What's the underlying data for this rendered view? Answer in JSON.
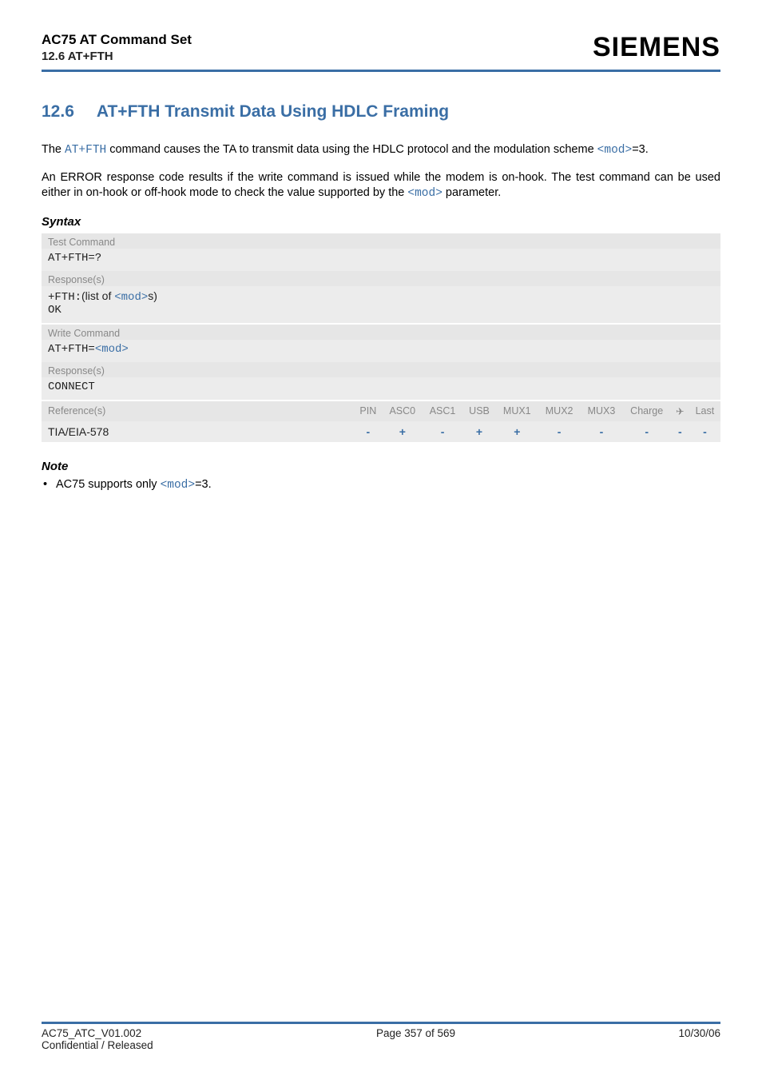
{
  "header": {
    "doc_title": "AC75 AT Command Set",
    "doc_section": "12.6 AT+FTH",
    "brand": "SIEMENS"
  },
  "section": {
    "number": "12.6",
    "title": "AT+FTH   Transmit Data Using HDLC Framing"
  },
  "para1_pre": "The ",
  "para1_link1": "AT+FTH",
  "para1_mid1": " command causes the TA to transmit data using the HDLC protocol and the modulation scheme ",
  "para1_link2": "<mod>",
  "para1_post": "=3.",
  "para2_pre": "An ERROR response code results if the write command is issued while the modem is on-hook. The test command can be used either in on-hook or off-hook mode to check the value supported by the ",
  "para2_link": "<mod>",
  "para2_post": " parameter.",
  "syntax_label": "Syntax",
  "syntax": {
    "test_cmd_label": "Test Command",
    "test_cmd": "AT+FTH=?",
    "resp_label": "Response(s)",
    "test_resp_prefix": "+FTH:",
    "test_resp_text": "(list of ",
    "test_resp_link": "<mod>",
    "test_resp_suffix": "s)",
    "test_resp_ok": "OK",
    "write_cmd_label": "Write Command",
    "write_cmd_prefix": "AT+FTH=",
    "write_cmd_link": "<mod>",
    "write_resp_label": "Response(s)",
    "write_resp": "CONNECT"
  },
  "ref": {
    "label": "Reference(s)",
    "cols": [
      "PIN",
      "ASC0",
      "ASC1",
      "USB",
      "MUX1",
      "MUX2",
      "MUX3",
      "Charge",
      "✈",
      "Last"
    ],
    "name": "TIA/EIA-578",
    "vals": [
      "-",
      "+",
      "-",
      "+",
      "+",
      "-",
      "-",
      "-",
      "-",
      "-"
    ]
  },
  "note_label": "Note",
  "note_pre": "AC75 supports only ",
  "note_link": "<mod>",
  "note_post": "=3.",
  "footer": {
    "left1": "AC75_ATC_V01.002",
    "left2": "Confidential / Released",
    "center": "Page 357 of 569",
    "right": "10/30/06"
  }
}
